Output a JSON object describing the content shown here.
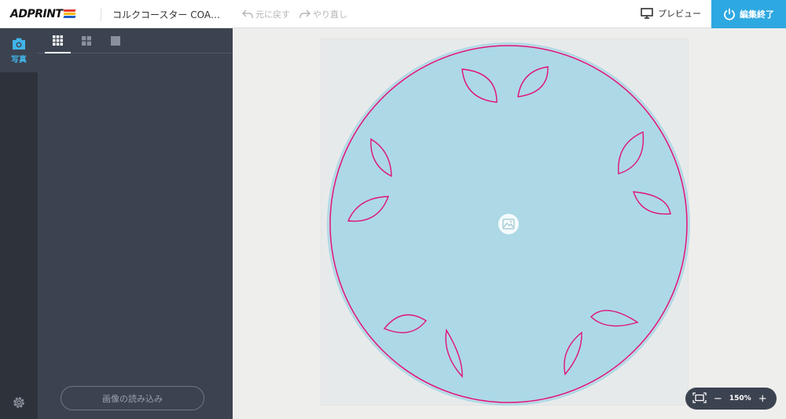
{
  "header": {
    "logo_text": "ADPRINT",
    "doc_title": "コルクコースター COA…",
    "undo_label": "元に戻す",
    "redo_label": "やり直し",
    "preview_label": "プレビュー",
    "finish_label": "編集終了"
  },
  "rail": {
    "photo_label": "写真"
  },
  "panel": {
    "import_label": "画像の読み込み"
  },
  "zoom": {
    "level": "150%",
    "minus": "−",
    "plus": "+"
  },
  "colors": {
    "accent": "#2ea8e0",
    "coaster_fill": "#add8e6",
    "cut_line": "#e0127a",
    "panel_bg": "#3c4350"
  }
}
